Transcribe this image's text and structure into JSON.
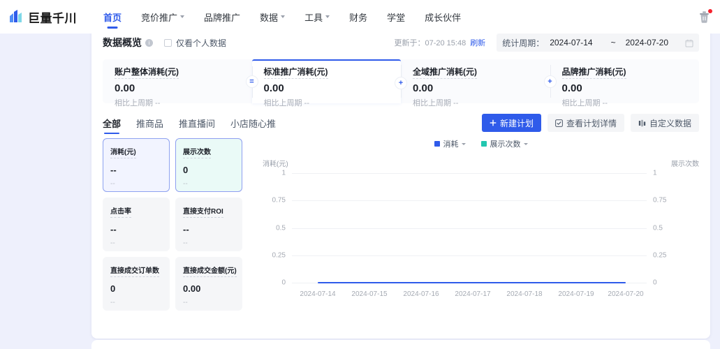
{
  "brand": {
    "name": "巨量千川",
    "logo_icon": "bar-chart-logo-icon"
  },
  "nav": {
    "items": [
      {
        "label": "首页",
        "active": true,
        "has_caret": false
      },
      {
        "label": "竞价推广",
        "active": false,
        "has_caret": true
      },
      {
        "label": "品牌推广",
        "active": false,
        "has_caret": false
      },
      {
        "label": "数据",
        "active": false,
        "has_caret": true
      },
      {
        "label": "工具",
        "active": false,
        "has_caret": true
      },
      {
        "label": "财务",
        "active": false,
        "has_caret": false
      },
      {
        "label": "学堂",
        "active": false,
        "has_caret": false
      },
      {
        "label": "成长伙伴",
        "active": false,
        "has_caret": false
      }
    ],
    "trash_icon": "trash-icon",
    "badge_color": "#f5222d"
  },
  "overview": {
    "title": "数据概览",
    "info_icon": "info-icon",
    "checkbox_label": "仅看个人数据",
    "checkbox_checked": false,
    "updated_text": "更新于：07-20 15:48",
    "refresh_label": "刷新",
    "period_label": "统计周期：",
    "date_start": "2024-07-14",
    "date_sep": "~",
    "date_end": "2024-07-20",
    "calendar_icon": "calendar-icon"
  },
  "cards": [
    {
      "title": "账户整体消耗(元)",
      "value": "0.00",
      "sub": "相比上周期 --",
      "op": "=",
      "selected": false
    },
    {
      "title": "标准推广消耗(元)",
      "value": "0.00",
      "sub": "相比上周期 --",
      "op": "+",
      "selected": true
    },
    {
      "title": "全域推广消耗(元)",
      "value": "0.00",
      "sub": "相比上周期 --",
      "op": "+",
      "selected": false
    },
    {
      "title": "品牌推广消耗(元)",
      "value": "0.00",
      "sub": "相比上周期 --",
      "op": "",
      "selected": false
    }
  ],
  "tabs": [
    {
      "label": "全部",
      "active": true
    },
    {
      "label": "推商品",
      "active": false
    },
    {
      "label": "推直播间",
      "active": false
    },
    {
      "label": "小店随心推",
      "active": false
    }
  ],
  "actions": {
    "new_plan": "新建计划",
    "new_plan_icon": "plus-icon",
    "view_detail": "查看计划详情",
    "view_detail_icon": "checkbox-square-icon",
    "custom_data": "自定义数据",
    "custom_data_icon": "columns-settings-icon",
    "primary_color": "#2f5bea"
  },
  "tiles": [
    {
      "title": "消耗(元)",
      "value": "--",
      "sub": "--",
      "state": "sel-a"
    },
    {
      "title": "展示次数",
      "value": "0",
      "sub": "--",
      "state": "sel-b"
    },
    {
      "title": "点击率",
      "value": "--",
      "sub": "--",
      "state": ""
    },
    {
      "title": "直接支付ROI",
      "value": "--",
      "sub": "--",
      "state": ""
    },
    {
      "title": "直接成交订单数",
      "value": "0",
      "sub": "--",
      "state": ""
    },
    {
      "title": "直接成交金额(元)",
      "value": "0.00",
      "sub": "--",
      "state": ""
    }
  ],
  "chart_data": {
    "type": "line",
    "title": "",
    "legend": [
      {
        "name": "消耗",
        "color": "#2f5bea"
      },
      {
        "name": "展示次数",
        "color": "#22c7b0"
      }
    ],
    "legend_position": "top-center",
    "grid": true,
    "xlabel": "",
    "ylabel": "消耗(元)",
    "y2label": "展示次数",
    "categories": [
      "2024-07-14",
      "2024-07-15",
      "2024-07-16",
      "2024-07-17",
      "2024-07-18",
      "2024-07-19",
      "2024-07-20"
    ],
    "yticks": [
      "1",
      "0.75",
      "0.5",
      "0.25",
      "0"
    ],
    "y2ticks": [
      "1",
      "0.75",
      "0.5",
      "0.25",
      "0"
    ],
    "ylim": [
      0,
      1
    ],
    "y2lim": [
      0,
      1
    ],
    "series": [
      {
        "name": "消耗",
        "color": "#2f5bea",
        "values": [
          0,
          0,
          0,
          0,
          0,
          0,
          0
        ]
      },
      {
        "name": "展示次数",
        "color": "#22c7b0",
        "values": [
          0,
          0,
          0,
          0,
          0,
          0,
          0
        ]
      }
    ]
  }
}
